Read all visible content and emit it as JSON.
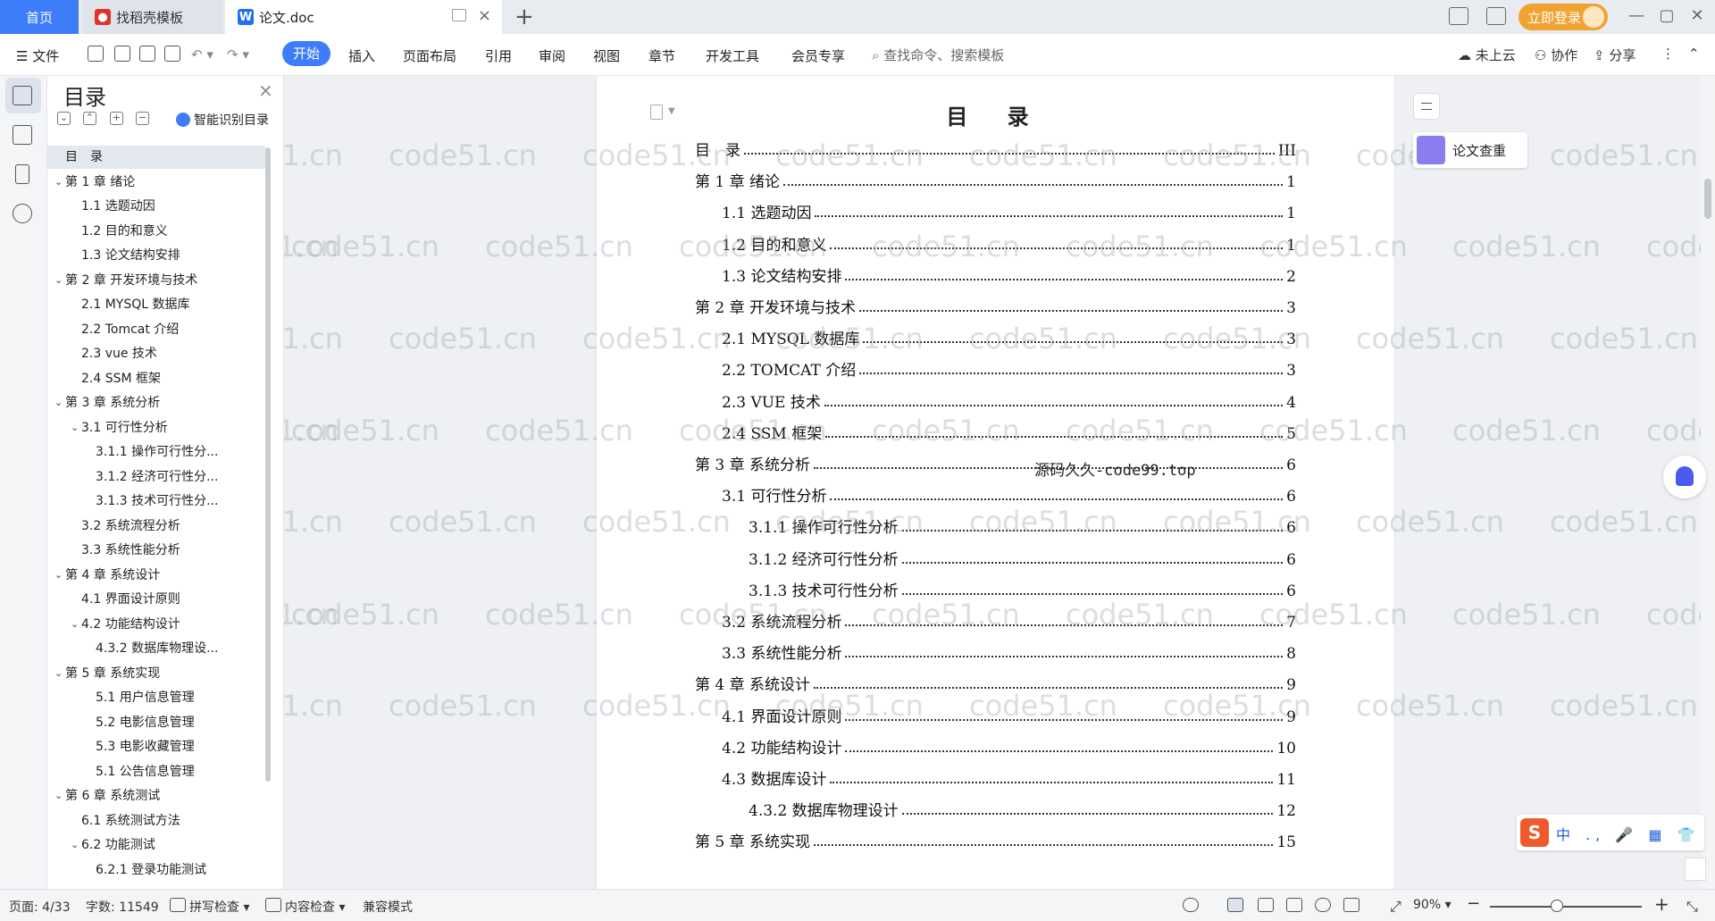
{
  "tabs": {
    "home": "首页",
    "template": "找稻壳模板",
    "doc": "论文.doc",
    "close_symbol": "×",
    "add_symbol": "+",
    "login": "立即登录",
    "win_min": "—",
    "win_max": "▢",
    "win_close": "✕"
  },
  "ribbon": {
    "file": "文件",
    "menus": [
      "开始",
      "插入",
      "页面布局",
      "引用",
      "审阅",
      "视图",
      "章节",
      "开发工具",
      "会员专享"
    ],
    "search_placeholder": "查找命令、搜索模板",
    "cloud": "未上云",
    "collab": "协作",
    "share": "分享",
    "more": "⋮"
  },
  "toc_panel": {
    "title": "目录",
    "close": "×",
    "smart_label": "智能识别目录",
    "items": [
      {
        "text": "目　录",
        "level": 0,
        "arrow": ""
      },
      {
        "text": "第 1 章  绪论",
        "level": 0,
        "arrow": "v"
      },
      {
        "text": "1.1 选题动因",
        "level": 1,
        "arrow": ""
      },
      {
        "text": "1.2 目的和意义",
        "level": 1,
        "arrow": ""
      },
      {
        "text": "1.3 论文结构安排",
        "level": 1,
        "arrow": ""
      },
      {
        "text": "第 2 章  开发环境与技术",
        "level": 0,
        "arrow": "v"
      },
      {
        "text": "2.1 MYSQL 数据库",
        "level": 1,
        "arrow": ""
      },
      {
        "text": "2.2 Tomcat  介绍",
        "level": 1,
        "arrow": ""
      },
      {
        "text": "2.3 vue 技术",
        "level": 1,
        "arrow": ""
      },
      {
        "text": "2.4 SSM 框架",
        "level": 1,
        "arrow": ""
      },
      {
        "text": "第 3 章  系统分析",
        "level": 0,
        "arrow": "v"
      },
      {
        "text": "3.1 可行性分析",
        "level": 1,
        "arrow": "v"
      },
      {
        "text": "3.1.1 操作可行性分...",
        "level": 2,
        "arrow": ""
      },
      {
        "text": "3.1.2 经济可行性分...",
        "level": 2,
        "arrow": ""
      },
      {
        "text": "3.1.3 技术可行性分...",
        "level": 2,
        "arrow": ""
      },
      {
        "text": "3.2 系统流程分析",
        "level": 1,
        "arrow": ""
      },
      {
        "text": "3.3 系统性能分析",
        "level": 1,
        "arrow": ""
      },
      {
        "text": "第 4 章  系统设计",
        "level": 0,
        "arrow": "v"
      },
      {
        "text": "4.1 界面设计原则",
        "level": 1,
        "arrow": ""
      },
      {
        "text": "4.2 功能结构设计",
        "level": 1,
        "arrow": "v"
      },
      {
        "text": "4.3.2  数据库物理设...",
        "level": 2,
        "arrow": ""
      },
      {
        "text": "第 5 章  系统实现",
        "level": 0,
        "arrow": "v"
      },
      {
        "text": "5.1 用户信息管理",
        "level": 2,
        "arrow": ""
      },
      {
        "text": "5.2  电影信息管理",
        "level": 2,
        "arrow": ""
      },
      {
        "text": "5.3 电影收藏管理",
        "level": 2,
        "arrow": ""
      },
      {
        "text": "5.1 公告信息管理",
        "level": 2,
        "arrow": ""
      },
      {
        "text": "第 6 章  系统测试",
        "level": 0,
        "arrow": "v"
      },
      {
        "text": "6.1  系统测试方法",
        "level": 1,
        "arrow": ""
      },
      {
        "text": "6.2  功能测试",
        "level": 1,
        "arrow": "v"
      },
      {
        "text": "6.2.1  登录功能测试",
        "level": 2,
        "arrow": ""
      }
    ]
  },
  "document": {
    "heading": "目 录",
    "overlay": "源码久久-code99.top",
    "entries": [
      {
        "label": "目　录",
        "page": "III",
        "level": 0
      },
      {
        "label": "第 1 章  绪论",
        "page": "1",
        "level": 0
      },
      {
        "label": "1.1 选题动因",
        "page": "1",
        "level": 1
      },
      {
        "label": "1.2 目的和意义",
        "page": "1",
        "level": 1
      },
      {
        "label": "1.3 论文结构安排",
        "page": "2",
        "level": 1
      },
      {
        "label": "第 2 章  开发环境与技术",
        "page": "3",
        "level": 0
      },
      {
        "label": "2.1 MYSQL 数据库",
        "page": "3",
        "level": 1
      },
      {
        "label": "2.2 TOMCAT  介绍",
        "page": "3",
        "level": 1
      },
      {
        "label": "2.3 VUE 技术",
        "page": "4",
        "level": 1
      },
      {
        "label": "2.4 SSM 框架",
        "page": "5",
        "level": 1
      },
      {
        "label": "第 3 章  系统分析",
        "page": "6",
        "level": 0
      },
      {
        "label": "3.1 可行性分析",
        "page": "6",
        "level": 1
      },
      {
        "label": "3.1.1 操作可行性分析",
        "page": "6",
        "level": 2
      },
      {
        "label": "3.1.2 经济可行性分析",
        "page": "6",
        "level": 2
      },
      {
        "label": "3.1.3 技术可行性分析",
        "page": "6",
        "level": 2
      },
      {
        "label": "3.2 系统流程分析",
        "page": "7",
        "level": 1
      },
      {
        "label": "3.3 系统性能分析",
        "page": "8",
        "level": 1
      },
      {
        "label": "第 4 章  系统设计",
        "page": "9",
        "level": 0
      },
      {
        "label": "4.1 界面设计原则",
        "page": "9",
        "level": 1
      },
      {
        "label": "4.2 功能结构设计",
        "page": "10",
        "level": 1
      },
      {
        "label": "4.3 数据库设计",
        "page": "11",
        "level": 1
      },
      {
        "label": "4.3.2  数据库物理设计",
        "page": "12",
        "level": 2
      },
      {
        "label": "第 5 章  系统实现",
        "page": "15",
        "level": 0
      }
    ]
  },
  "watermark": "code51.cn",
  "side_tools": {
    "paper_check": "论文查重"
  },
  "ime": {
    "logo": "S",
    "items": "中 ., 🎤 ▦ 👕 ⋮"
  },
  "statusbar": {
    "page": "页面: 4/33",
    "words": "字数: 11549",
    "spell": "拼写检查",
    "content_check": "内容检查",
    "compat": "兼容模式",
    "zoom": "90%",
    "zoom_minus": "−",
    "zoom_plus": "+",
    "fit": "⤢"
  },
  "colors": {
    "accent": "#3d7dfa",
    "login": "#f0a331",
    "paper_check_icon": "#8a7df0"
  }
}
